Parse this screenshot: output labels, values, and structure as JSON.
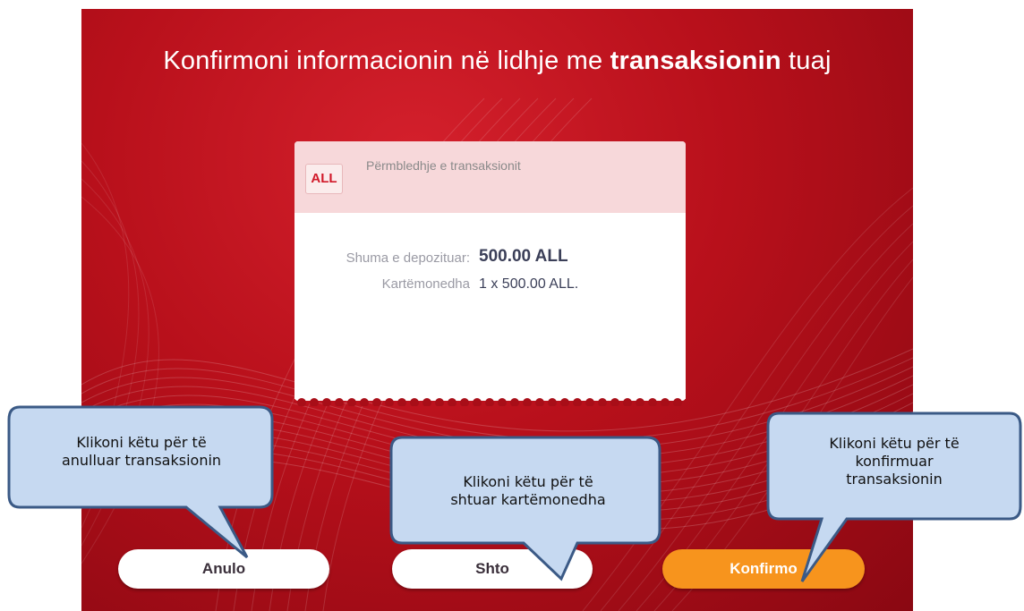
{
  "screen": {
    "title_part1": "Konfirmoni informacionin në lidhje me ",
    "title_bold": "transaksionin",
    "title_part2": " tuaj"
  },
  "summary": {
    "currency_badge": "ALL",
    "title": "Përmbledhje e transaksionit",
    "deposit_label": "Shuma e depozituar:",
    "deposit_value": "500.00 ALL",
    "banknotes_label": "Kartëmonedha",
    "banknotes_value": "1 x 500.00 ALL."
  },
  "buttons": {
    "cancel": "Anulo",
    "add": "Shto",
    "confirm": "Konfirmo"
  },
  "callouts": {
    "cancel_line1": "Klikoni këtu për të",
    "cancel_line2": "anulluar transaksionin",
    "add_line1": "Klikoni këtu për të",
    "add_line2": "shtuar kartëmonedha",
    "confirm_line1": "Klikoni këtu për të",
    "confirm_line2": "konfirmuar",
    "confirm_line3": "transaksionin"
  },
  "colors": {
    "background_red": "#c0141f",
    "confirm_orange": "#f7941d",
    "callout_fill": "#c6d9f1",
    "callout_border": "#3b5a86"
  }
}
